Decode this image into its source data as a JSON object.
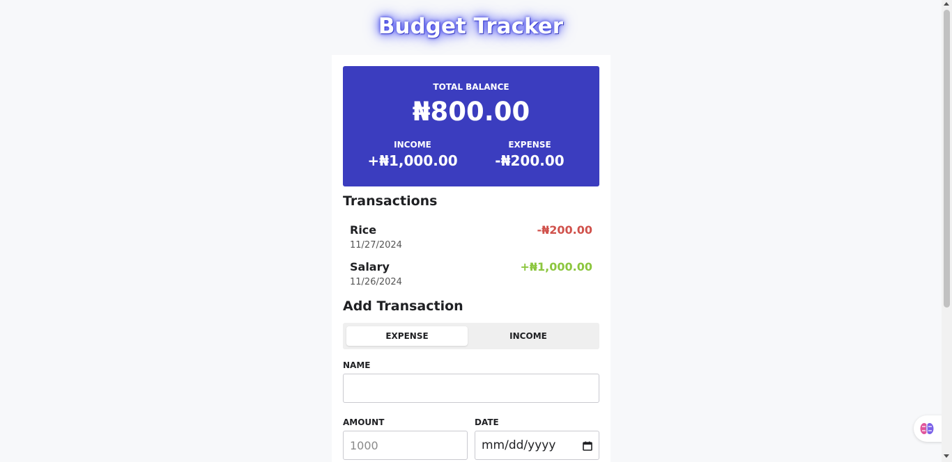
{
  "app": {
    "title": "Budget Tracker"
  },
  "balance": {
    "total_label": "TOTAL BALANCE",
    "total_amount": "₦800.00",
    "income_label": "INCOME",
    "income_amount": "+₦1,000.00",
    "expense_label": "EXPENSE",
    "expense_amount": "-₦200.00"
  },
  "transactions": {
    "heading": "Transactions",
    "items": [
      {
        "name": "Rice",
        "date": "11/27/2024",
        "amount": "-₦200.00",
        "type": "expense"
      },
      {
        "name": "Salary",
        "date": "11/26/2024",
        "amount": "+₦1,000.00",
        "type": "income"
      }
    ]
  },
  "add_transaction": {
    "heading": "Add Transaction",
    "tabs": [
      {
        "label": "EXPENSE",
        "active": true
      },
      {
        "label": "INCOME",
        "active": false
      }
    ],
    "name_label": "NAME",
    "name_value": "",
    "amount_label": "AMOUNT",
    "amount_placeholder": "1000",
    "date_label": "DATE",
    "date_placeholder": "mm/dd/yyyy"
  },
  "colors": {
    "balance_card": "#3b3dbf",
    "expense": "#d0524c",
    "income": "#8cc63f"
  },
  "icons": {
    "date_picker": "calendar-icon",
    "extension": "brain-icon"
  }
}
